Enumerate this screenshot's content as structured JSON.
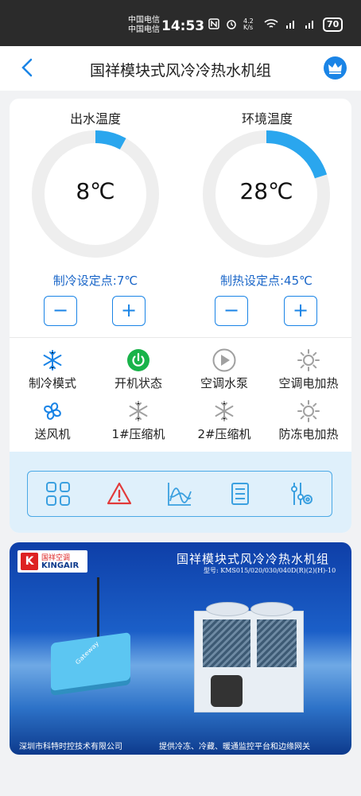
{
  "status_bar": {
    "carrier_1": "中国电信",
    "carrier_2": "中国电信",
    "time": "14:53",
    "speed": "4.2 K/s",
    "battery": "70"
  },
  "header": {
    "title": "国祥模块式风冷冷热水机组",
    "back_icon": "chevron-left-icon",
    "crown_icon": "crown-icon"
  },
  "gauges": [
    {
      "label": "出水温度",
      "value": "8℃",
      "level": 0.08
    },
    {
      "label": "环境温度",
      "value": "28℃",
      "level": 0.2
    }
  ],
  "setpoints": [
    {
      "label": "制冷设定点:7℃"
    },
    {
      "label": "制热设定点:45℃"
    }
  ],
  "stepper": {
    "minus": "−",
    "plus": "+"
  },
  "status_items": [
    {
      "label": "制冷模式",
      "icon": "snowflake-icon",
      "color": "#1a84e6"
    },
    {
      "label": "开机状态",
      "icon": "power-icon",
      "color": "#19b34a"
    },
    {
      "label": "空调水泵",
      "icon": "play-pump-icon",
      "color": "#a0a0a0"
    },
    {
      "label": "空调电加热",
      "icon": "sun-heater-icon",
      "color": "#a0a0a0"
    },
    {
      "label": "送风机",
      "icon": "fan-icon",
      "color": "#1a84e6"
    },
    {
      "label": "1#压缩机",
      "icon": "snowflake-icon",
      "color": "#a0a0a0"
    },
    {
      "label": "2#压缩机",
      "icon": "snowflake-icon",
      "color": "#a0a0a0"
    },
    {
      "label": "防冻电加热",
      "icon": "sun-heater-icon",
      "color": "#a0a0a0"
    }
  ],
  "bottom_nav": [
    {
      "icon": "grid-icon"
    },
    {
      "icon": "alarm-warning-icon"
    },
    {
      "icon": "trend-chart-icon"
    },
    {
      "icon": "document-list-icon"
    },
    {
      "icon": "settings-sliders-icon"
    }
  ],
  "banner": {
    "logo_cn": "国祥空调",
    "logo_en": "KINGAIR",
    "title": "国祥模块式风冷冷热水机组",
    "model": "型号: KMS015/020/030/040D(R)(2)(H)-10",
    "gateway_label": "Gateway",
    "company": "深圳市科特时控技术有限公司",
    "slogan": "提供冷冻、冷藏、暖通监控平台和边缘网关"
  }
}
